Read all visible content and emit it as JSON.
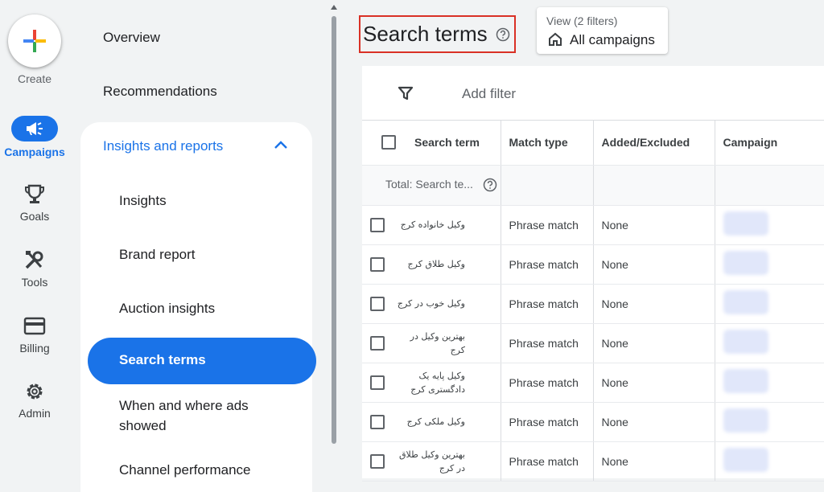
{
  "rail": {
    "create_label": "Create",
    "items": [
      {
        "label": "Campaigns",
        "icon": "megaphone-icon",
        "active": true
      },
      {
        "label": "Goals",
        "icon": "trophy-icon"
      },
      {
        "label": "Tools",
        "icon": "tools-icon"
      },
      {
        "label": "Billing",
        "icon": "credit-card-icon"
      },
      {
        "label": "Admin",
        "icon": "gear-icon"
      }
    ]
  },
  "nav": {
    "overview": "Overview",
    "recommendations": "Recommendations",
    "group_title": "Insights and reports",
    "sub_items": [
      "Insights",
      "Brand report",
      "Auction insights",
      "Search terms",
      "When and where ads showed",
      "Channel performance"
    ],
    "active_item": "Search terms"
  },
  "header": {
    "title": "Search terms",
    "view_small": "View (2 filters)",
    "view_big": "All campaigns"
  },
  "filter": {
    "label": "Add filter"
  },
  "table": {
    "columns": [
      "Search term",
      "Match type",
      "Added/Excluded",
      "Campaign"
    ],
    "total_label": "Total: Search te...",
    "rows": [
      {
        "term": "وکیل خانواده کرج",
        "match": "Phrase match",
        "added": "None"
      },
      {
        "term": "وکیل طلاق کرج",
        "match": "Phrase match",
        "added": "None"
      },
      {
        "term": "وکیل خوب در کرج",
        "match": "Phrase match",
        "added": "None"
      },
      {
        "term": "بهترین وکیل در کرج",
        "match": "Phrase match",
        "added": "None"
      },
      {
        "term": "وکیل پایه یک دادگستری کرج",
        "match": "Phrase match",
        "added": "None"
      },
      {
        "term": "وکیل ملکی کرج",
        "match": "Phrase match",
        "added": "None"
      },
      {
        "term": "بهترین وکیل طلاق در کرج",
        "match": "Phrase match",
        "added": "None"
      }
    ]
  },
  "colors": {
    "accent": "#1a73e8",
    "highlight_border": "#d93025"
  }
}
